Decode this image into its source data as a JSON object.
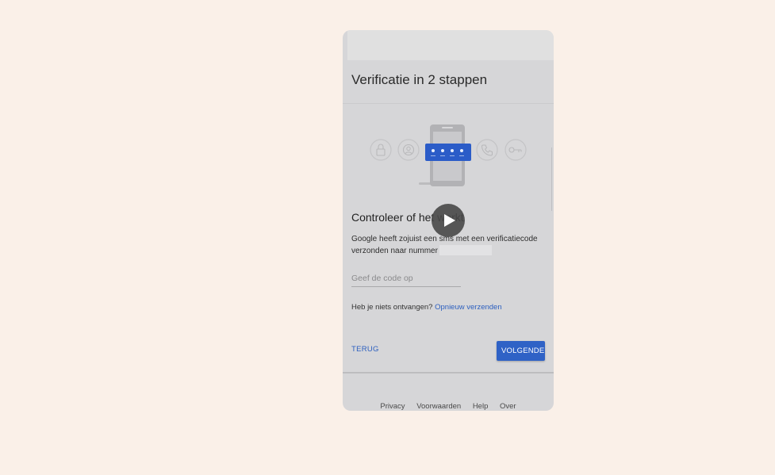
{
  "page": {
    "title": "Verificatie in 2 stappen",
    "section_title": "Controleer of het werkt",
    "description": "Google heeft zojuist een sms met een verificatiecode verzonden naar nummer",
    "code_input": {
      "placeholder": "Geef de code op",
      "value": ""
    },
    "resend": {
      "prompt": "Heb je niets ontvangen?",
      "link": "Opnieuw verzenden"
    },
    "buttons": {
      "back": "TERUG",
      "next": "VOLGENDE"
    },
    "footer": {
      "links": [
        "Privacy",
        "Voorwaarden",
        "Help",
        "Over"
      ]
    }
  },
  "illustration": {
    "icons": [
      "lock-icon",
      "account-icon",
      "phone-call-icon",
      "key-icon"
    ],
    "code_dots": 4
  },
  "colors": {
    "page_background": "#faf0e8",
    "card_background": "#d6d6d8",
    "accent_blue": "#2f62c6",
    "code_screen_blue": "#2b5cc8"
  }
}
